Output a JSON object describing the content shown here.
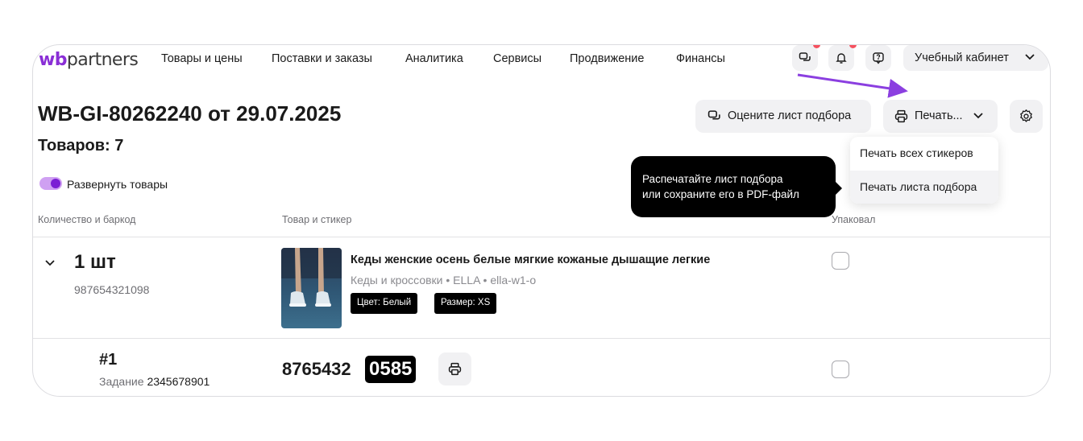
{
  "colors": {
    "brand": "#8a2fd6",
    "accent_purple": "#7b1fd4",
    "badge_red": "#f5515f",
    "arrow": "#8b3fe0"
  },
  "logo": {
    "wb": "wb",
    "partners": "partners"
  },
  "nav": {
    "items": [
      "Товары и цены",
      "Поставки и заказы",
      "Аналитика",
      "Сервисы",
      "Продвижение",
      "Финансы"
    ],
    "icons": [
      "chat-icon",
      "bell-icon",
      "support-icon"
    ],
    "cabinet_label": "Учебный кабинет"
  },
  "page": {
    "title": "WB-GI-80262240 от 29.07.2025",
    "count": "Товаров: 7",
    "expand_toggle_label": "Развернуть товары",
    "expand_toggle_on": true
  },
  "actions": {
    "rate_label": "Оцените лист подбора",
    "print_label": "Печать...",
    "print_menu": [
      "Печать всех стикеров",
      "Печать листа подбора"
    ],
    "print_menu_highlighted": 1
  },
  "tooltip": {
    "line1": "Распечатайте лист подбора",
    "line2": "или сохраните его в PDF-файл"
  },
  "table": {
    "headers": [
      "Количество и баркод",
      "Товар и стикер",
      "Упаковал"
    ],
    "product": {
      "qty": "1 шт",
      "barcode": "987654321098",
      "name": "Кеды женские осень белые мягкие кожаные дышащие легкие",
      "meta": "Кеды и кроссовки • ELLA • ella-w1-o",
      "tags": [
        "Цвет: Белый",
        "Размер: XS"
      ],
      "packed": false
    },
    "task": {
      "num": "#1",
      "task_label": "Задание",
      "task_id": "2345678901",
      "sticker_prefix": "8765432",
      "sticker_suffix": "0585",
      "packed": false
    }
  }
}
